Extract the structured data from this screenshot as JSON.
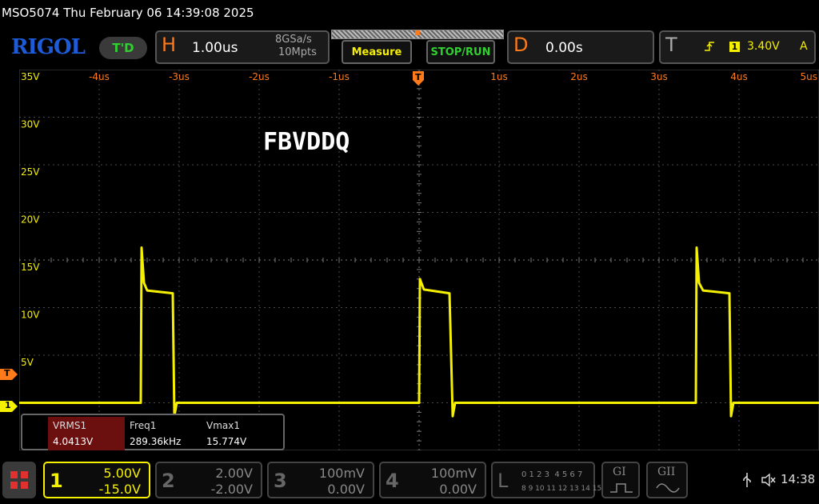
{
  "window_title": "MSO5074  Thu February 06 14:39:08 2025",
  "header": {
    "logo": "RIGOL",
    "trig_status": "T'D",
    "horizontal": {
      "letter": "H",
      "timebase": "1.00us",
      "sample_rate": "8GSa/s",
      "memory_depth": "10Mpts"
    },
    "measure_label": "Measure",
    "stoprun_label": "STOP/RUN",
    "delay": {
      "letter": "D",
      "value": "0.00s"
    },
    "trigger": {
      "letter": "T",
      "channel": "1",
      "level": "3.40V",
      "mode": "A"
    }
  },
  "grid": {
    "x_tick_labels": [
      "-4us",
      "-3us",
      "-2us",
      "-1us",
      "",
      "1us",
      "2us",
      "3us",
      "4us",
      "5us"
    ],
    "y_tick_labels": [
      "35V",
      "30V",
      "25V",
      "20V",
      "15V",
      "10V",
      "5V"
    ],
    "trigger_marker": "T",
    "ch1_marker": "1",
    "trig_level_marker": "T"
  },
  "waveform_label": "FBVDDQ",
  "measurements": {
    "headers": [
      "VRMS1",
      "Freq1",
      "Vmax1"
    ],
    "values": [
      "4.0413V",
      "289.36kHz",
      "15.774V"
    ]
  },
  "channels": [
    {
      "num": "1",
      "scale": "5.00V",
      "offset": "-15.0V",
      "active": true
    },
    {
      "num": "2",
      "scale": "2.00V",
      "offset": "-2.00V",
      "active": false
    },
    {
      "num": "3",
      "scale": "100mV",
      "offset": "0.00V",
      "active": false
    },
    {
      "num": "4",
      "scale": "100mV",
      "offset": "0.00V",
      "active": false
    }
  ],
  "logic": {
    "letter": "L",
    "row1": "0 1 2 3  4 5 6 7",
    "row2": "8 9 10 11 12 13 14 15"
  },
  "gen1_label": "GI",
  "gen2_label": "GII",
  "clock": "14:38",
  "colors": {
    "ch1": "#f5f000",
    "accent": "#ff7a1a",
    "grid": "#4a4a4a",
    "measure_header": "#6b0f0f"
  },
  "chart_data": {
    "type": "line",
    "title": "FBVDDQ",
    "xlabel": "",
    "ylabel": "",
    "x_unit": "us",
    "y_unit": "V",
    "xlim": [
      -5,
      5
    ],
    "ylim": [
      -5,
      35
    ],
    "grid": true,
    "series": [
      {
        "name": "1",
        "points": [
          [
            -5,
            0
          ],
          [
            -3.48,
            0
          ],
          [
            -3.47,
            16.3
          ],
          [
            -3.44,
            12.6
          ],
          [
            -3.4,
            11.8
          ],
          [
            -3.08,
            11.5
          ],
          [
            -3.06,
            -1.4
          ],
          [
            -3.03,
            0
          ],
          [
            0,
            0
          ],
          [
            0.01,
            13
          ],
          [
            0.06,
            11.9
          ],
          [
            0.38,
            11.5
          ],
          [
            0.42,
            -1.4
          ],
          [
            0.45,
            0
          ],
          [
            3.46,
            0
          ],
          [
            3.47,
            16.3
          ],
          [
            3.5,
            12.6
          ],
          [
            3.55,
            11.8
          ],
          [
            3.88,
            11.5
          ],
          [
            3.9,
            -1.4
          ],
          [
            3.93,
            0
          ],
          [
            5,
            0
          ]
        ]
      }
    ]
  }
}
